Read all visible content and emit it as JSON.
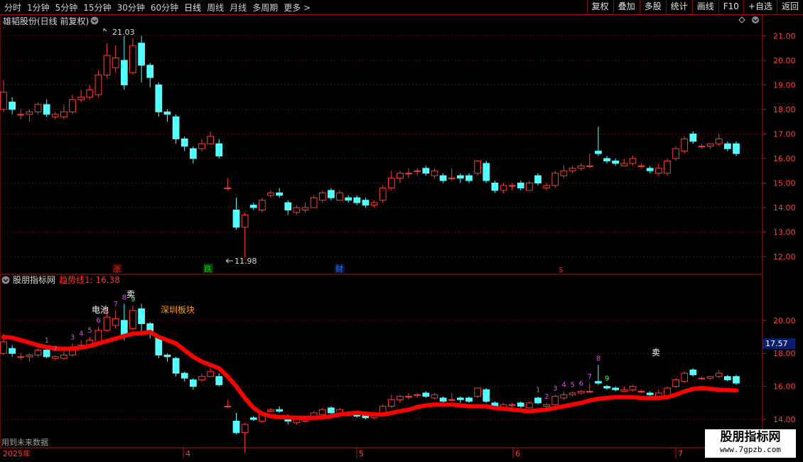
{
  "toolbar": {
    "periods": [
      "分时",
      "1分钟",
      "5分钟",
      "15分钟",
      "30分钟",
      "60分钟",
      "日线",
      "周线",
      "月线",
      "多周期",
      "更多 >"
    ],
    "active_period": "日线",
    "right_buttons": [
      "复权",
      "叠加",
      "多股",
      "统计",
      "画线",
      "F10",
      "+自选",
      "返回"
    ]
  },
  "main_panel": {
    "title": "雄韬股份(日线 前复权)",
    "high_label": "21.03",
    "low_label": "11.98",
    "y_ticks": [
      "21.00",
      "20.00",
      "19.00",
      "18.00",
      "17.00",
      "16.00",
      "15.00",
      "14.00",
      "13.00",
      "12.00"
    ],
    "event_markers": [
      {
        "label": "涨",
        "color": "#e02020"
      },
      {
        "label": "跌",
        "color": "#20c020"
      },
      {
        "label": "财",
        "color": "#3070ff"
      },
      {
        "label": "$",
        "color": "#e02020"
      }
    ]
  },
  "indicator_panel": {
    "title": "股朋指标网",
    "trend_label": "趋势线1: 16.38",
    "y_ticks": [
      "20.00",
      "18.00",
      "16.00",
      "14.00"
    ],
    "current_value_tag": "17.57",
    "sector_text": "深圳板块",
    "concept_text": "电池",
    "sell_label": "卖",
    "footer_note": "用到未来数据"
  },
  "x_axis": {
    "labels": [
      "2025年",
      "4",
      "5",
      "6",
      "7"
    ]
  },
  "watermark": {
    "line1": "股朋指标网",
    "line2": "www.7gpzb.com"
  },
  "colors": {
    "up": "#ff3a3a",
    "down": "#54ffff",
    "trend": "#ff0000",
    "grid": "#5a0a0a",
    "axis": "#b01818",
    "tick_text": "#ff4040",
    "count_purple": "#d050e0",
    "count_green": "#40ff40"
  },
  "chart_data": {
    "type": "candlestick",
    "x": [
      "c1",
      "c2",
      "c3",
      "c4",
      "c5",
      "c6",
      "c7",
      "c8",
      "c9",
      "c10",
      "c11",
      "c12",
      "c13",
      "c14",
      "c15",
      "c16",
      "c17",
      "c18",
      "c19",
      "c20",
      "c21",
      "c22",
      "c23",
      "c24",
      "c25",
      "c26",
      "c27",
      "c28",
      "c29",
      "c30",
      "c31",
      "c32",
      "c33",
      "c34",
      "c35",
      "c36",
      "c37",
      "c38",
      "c39",
      "c40",
      "c41",
      "c42",
      "c43",
      "c44",
      "c45",
      "c46",
      "c47",
      "c48",
      "c49",
      "c50",
      "c51",
      "c52",
      "c53",
      "c54",
      "c55",
      "c56",
      "c57",
      "c58",
      "c59",
      "c60",
      "c61",
      "c62",
      "c63",
      "c64",
      "c65",
      "c66",
      "c67",
      "c68",
      "c69",
      "c70",
      "c71",
      "c72",
      "c73",
      "c74",
      "c75",
      "c76",
      "c77",
      "c78",
      "c79",
      "c80",
      "c81",
      "c82",
      "c83",
      "c84",
      "c85",
      "c86"
    ],
    "candles": [
      [
        18.0,
        18.7,
        19.2,
        17.9
      ],
      [
        18.3,
        18.0,
        18.5,
        17.8
      ],
      [
        17.8,
        17.8,
        18.0,
        17.6
      ],
      [
        17.8,
        17.9,
        18.0,
        17.5
      ],
      [
        17.9,
        18.2,
        18.3,
        17.8
      ],
      [
        18.2,
        17.8,
        18.4,
        17.7
      ],
      [
        17.7,
        17.8,
        17.9,
        17.6
      ],
      [
        17.7,
        17.9,
        18.2,
        17.6
      ],
      [
        17.9,
        18.4,
        18.6,
        17.8
      ],
      [
        18.4,
        18.5,
        18.8,
        18.3
      ],
      [
        18.5,
        18.8,
        19.0,
        18.4
      ],
      [
        18.6,
        19.4,
        19.6,
        18.5
      ],
      [
        19.4,
        20.2,
        20.7,
        19.3
      ],
      [
        19.7,
        20.1,
        20.6,
        19.5
      ],
      [
        20.0,
        19.0,
        21.0,
        18.8
      ],
      [
        19.5,
        20.6,
        20.9,
        19.4
      ],
      [
        20.7,
        19.8,
        21.0,
        19.1
      ],
      [
        19.8,
        19.3,
        19.9,
        18.9
      ],
      [
        19.0,
        17.9,
        19.1,
        17.7
      ],
      [
        17.9,
        17.8,
        18.0,
        17.5
      ],
      [
        17.7,
        16.8,
        17.8,
        16.6
      ],
      [
        16.8,
        16.5,
        16.9,
        16.3
      ],
      [
        16.4,
        16.0,
        16.5,
        15.8
      ],
      [
        16.4,
        16.6,
        16.8,
        16.3
      ],
      [
        16.6,
        16.9,
        17.1,
        16.6
      ],
      [
        16.6,
        16.1,
        16.8,
        16.0
      ],
      [
        14.8,
        14.8,
        15.2,
        14.7
      ],
      [
        13.9,
        13.2,
        14.4,
        13.1
      ],
      [
        13.2,
        13.7,
        13.8,
        11.98
      ],
      [
        14.1,
        14.0,
        14.2,
        13.9
      ],
      [
        13.9,
        14.3,
        14.4,
        13.8
      ],
      [
        14.5,
        14.6,
        14.7,
        14.4
      ],
      [
        14.6,
        14.5,
        14.8,
        14.4
      ],
      [
        14.2,
        13.9,
        14.3,
        13.7
      ],
      [
        13.8,
        14.0,
        14.1,
        13.7
      ],
      [
        13.9,
        14.0,
        14.2,
        13.8
      ],
      [
        14.0,
        14.4,
        14.5,
        14.0
      ],
      [
        14.3,
        14.6,
        14.7,
        14.2
      ],
      [
        14.7,
        14.4,
        14.8,
        14.3
      ],
      [
        14.3,
        14.6,
        14.7,
        14.3
      ],
      [
        14.4,
        14.3,
        14.5,
        14.2
      ],
      [
        14.4,
        14.2,
        14.5,
        14.1
      ],
      [
        14.3,
        14.1,
        14.4,
        14.0
      ],
      [
        14.1,
        14.2,
        14.3,
        14.0
      ],
      [
        14.3,
        14.8,
        14.9,
        14.2
      ],
      [
        14.8,
        15.2,
        15.5,
        14.7
      ],
      [
        15.2,
        15.4,
        15.5,
        15.0
      ],
      [
        15.4,
        15.4,
        15.6,
        15.2
      ],
      [
        15.5,
        15.5,
        15.6,
        15.3
      ],
      [
        15.6,
        15.4,
        15.7,
        15.3
      ],
      [
        15.3,
        15.5,
        15.6,
        15.2
      ],
      [
        15.3,
        15.1,
        15.4,
        15.0
      ],
      [
        15.2,
        15.2,
        15.6,
        15.1
      ],
      [
        15.3,
        15.2,
        15.4,
        15.0
      ],
      [
        15.3,
        15.1,
        15.4,
        15.0
      ],
      [
        15.4,
        15.9,
        15.9,
        15.3
      ],
      [
        15.8,
        15.1,
        15.9,
        15.0
      ],
      [
        15.0,
        14.7,
        15.1,
        14.6
      ],
      [
        14.7,
        14.9,
        15.0,
        14.6
      ],
      [
        14.9,
        14.9,
        15.0,
        14.7
      ],
      [
        15.0,
        14.8,
        15.1,
        14.7
      ],
      [
        14.7,
        15.0,
        15.1,
        14.7
      ],
      [
        15.3,
        15.0,
        15.4,
        14.9
      ],
      [
        14.8,
        14.9,
        15.0,
        14.7
      ],
      [
        14.9,
        15.4,
        15.5,
        14.8
      ],
      [
        15.3,
        15.5,
        15.7,
        15.2
      ],
      [
        15.5,
        15.6,
        15.7,
        15.4
      ],
      [
        15.6,
        15.7,
        15.8,
        15.5
      ],
      [
        15.7,
        15.7,
        16.2,
        15.6
      ],
      [
        16.3,
        16.2,
        17.3,
        16.1
      ],
      [
        16.0,
        15.9,
        16.1,
        15.8
      ],
      [
        15.9,
        15.8,
        16.0,
        15.7
      ],
      [
        15.7,
        15.8,
        16.0,
        15.7
      ],
      [
        15.8,
        16.0,
        16.1,
        15.7
      ],
      [
        15.7,
        15.7,
        15.8,
        15.6
      ],
      [
        15.6,
        15.5,
        15.7,
        15.4
      ],
      [
        15.4,
        15.6,
        15.8,
        15.3
      ],
      [
        15.4,
        15.9,
        16.0,
        15.3
      ],
      [
        16.0,
        16.4,
        16.5,
        15.9
      ],
      [
        16.3,
        16.8,
        16.9,
        16.2
      ],
      [
        17.0,
        16.7,
        17.1,
        16.6
      ],
      [
        16.5,
        16.5,
        16.6,
        16.4
      ],
      [
        16.5,
        16.6,
        16.6,
        16.4
      ],
      [
        16.6,
        16.8,
        17.0,
        16.5
      ],
      [
        16.6,
        16.4,
        16.7,
        16.3
      ],
      [
        16.6,
        16.2,
        16.7,
        16.1
      ]
    ],
    "trend_line": [
      19.0,
      18.95,
      18.8,
      18.65,
      18.5,
      18.38,
      18.3,
      18.28,
      18.3,
      18.35,
      18.45,
      18.6,
      18.75,
      18.9,
      19.05,
      19.2,
      19.22,
      19.3,
      19.0,
      18.8,
      18.6,
      18.2,
      17.8,
      17.5,
      17.3,
      17.1,
      16.6,
      16.0,
      15.3,
      14.7,
      14.35,
      14.2,
      14.15,
      14.12,
      14.1,
      14.1,
      14.1,
      14.12,
      14.2,
      14.3,
      14.35,
      14.4,
      14.35,
      14.3,
      14.3,
      14.4,
      14.5,
      14.6,
      14.75,
      14.85,
      14.9,
      14.9,
      14.9,
      14.85,
      14.8,
      14.8,
      14.8,
      14.7,
      14.65,
      14.6,
      14.55,
      14.5,
      14.55,
      14.6,
      14.7,
      14.8,
      14.9,
      15.0,
      15.15,
      15.25,
      15.3,
      15.35,
      15.35,
      15.35,
      15.3,
      15.3,
      15.3,
      15.35,
      15.5,
      15.7,
      15.85,
      15.9,
      15.85,
      15.8,
      15.78,
      15.75
    ],
    "counts": [
      {
        "i": 5,
        "label": "1",
        "color": "purple"
      },
      {
        "i": 6,
        "label": "2",
        "color": "purple"
      },
      {
        "i": 8,
        "label": "3",
        "color": "purple"
      },
      {
        "i": 9,
        "label": "4",
        "color": "purple"
      },
      {
        "i": 10,
        "label": "5",
        "color": "purple"
      },
      {
        "i": 11,
        "label": "6",
        "color": "purple"
      },
      {
        "i": 13,
        "label": "7",
        "color": "purple"
      },
      {
        "i": 14,
        "label": "8",
        "color": "purple"
      },
      {
        "i": 15,
        "label": "9",
        "color": "green"
      },
      {
        "i": 62,
        "label": "1",
        "color": "purple"
      },
      {
        "i": 63,
        "label": "2",
        "color": "purple"
      },
      {
        "i": 64,
        "label": "3",
        "color": "purple"
      },
      {
        "i": 65,
        "label": "4",
        "color": "purple"
      },
      {
        "i": 66,
        "label": "5",
        "color": "purple"
      },
      {
        "i": 67,
        "label": "6",
        "color": "purple"
      },
      {
        "i": 68,
        "label": "7",
        "color": "purple"
      },
      {
        "i": 69,
        "label": "8",
        "color": "purple"
      },
      {
        "i": 70,
        "label": "9",
        "color": "green"
      }
    ],
    "main_ylim": [
      11.8,
      21.3
    ],
    "indicator_ylim": [
      12.8,
      22.1
    ]
  }
}
